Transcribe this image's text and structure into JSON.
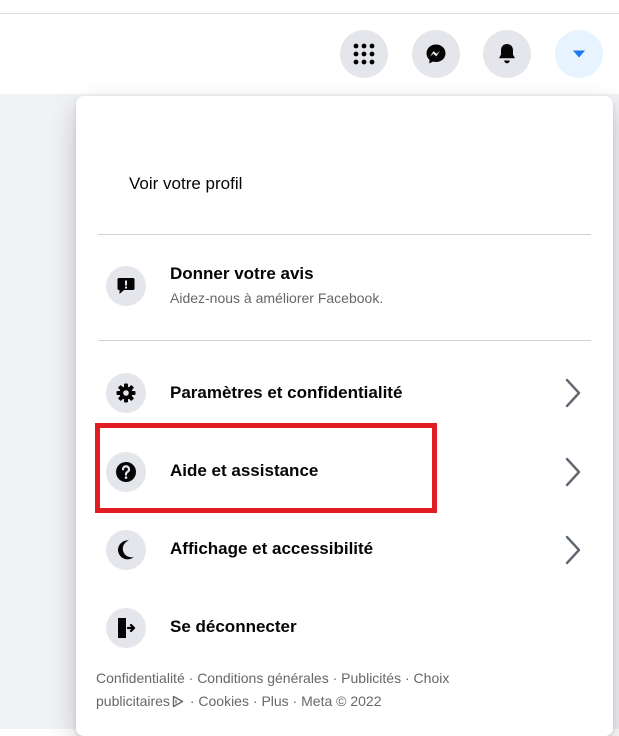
{
  "colors": {
    "accent": "#1877f2",
    "highlight": "#e31b23",
    "icon_bg": "#e4e6eb",
    "secondary_text": "#65676b"
  },
  "top_nav": {
    "buttons": [
      {
        "icon": "grid-menu-icon"
      },
      {
        "icon": "messenger-icon"
      },
      {
        "icon": "bell-icon"
      },
      {
        "icon": "caret-down-icon",
        "active": true
      }
    ]
  },
  "menu": {
    "profile_link": "Voir votre profil",
    "feedback": {
      "icon": "feedback-exclamation-icon",
      "title": "Donner votre avis",
      "subtitle": "Aidez-nous à améliorer Facebook."
    },
    "items": [
      {
        "icon": "gear-icon",
        "label": "Paramètres et confidentialité",
        "has_chevron": true
      },
      {
        "icon": "question-icon",
        "label": "Aide et assistance",
        "has_chevron": true,
        "highlighted": true
      },
      {
        "icon": "moon-icon",
        "label": "Affichage et accessibilité",
        "has_chevron": true
      },
      {
        "icon": "logout-door-icon",
        "label": "Se déconnecter",
        "has_chevron": false
      }
    ]
  },
  "footer": {
    "privacy": "Confidentialité",
    "terms": "Conditions générales",
    "ads": "Publicités",
    "ad_choices_a": "Choix",
    "ad_choices_b": "publicitaires",
    "cookies": "Cookies",
    "more": "Plus",
    "copyright": "Meta © 2022",
    "separator": " · "
  }
}
